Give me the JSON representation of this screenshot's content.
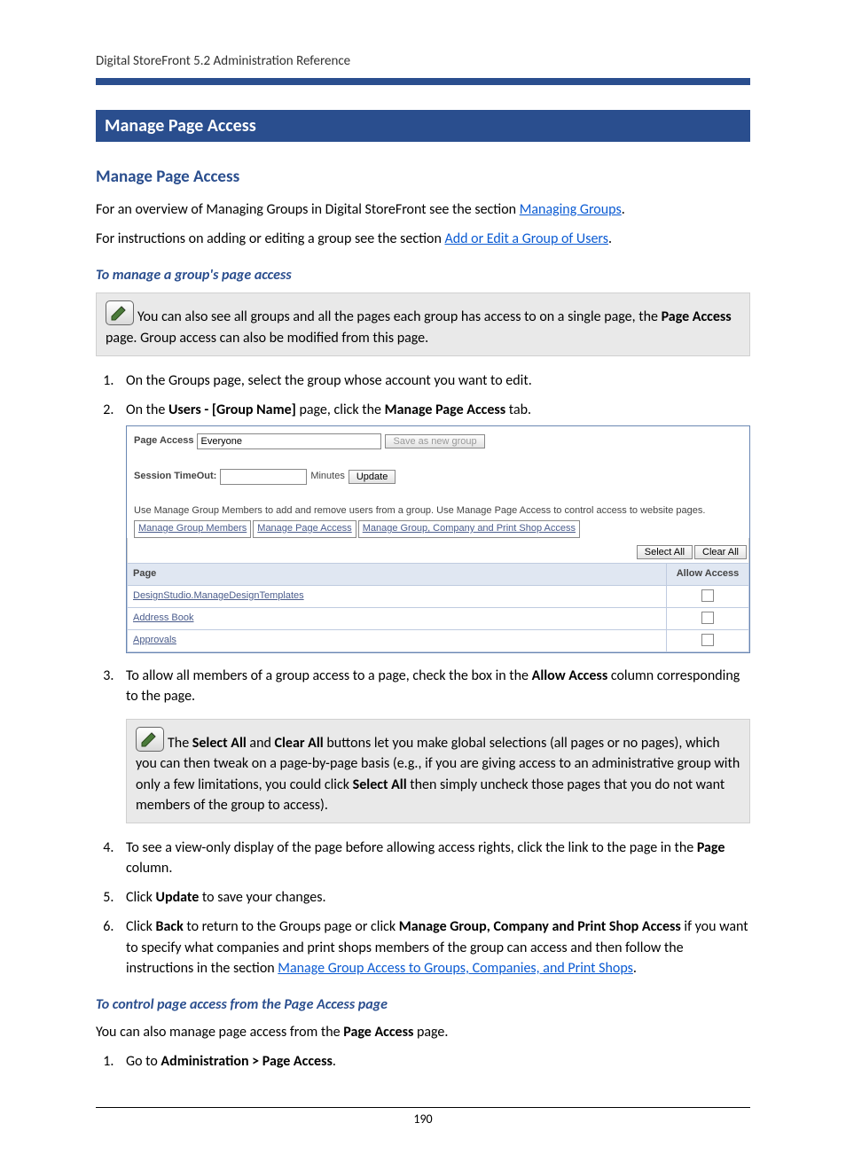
{
  "header": {
    "doc_title": "Digital StoreFront 5.2 Administration Reference"
  },
  "titlebar": "Manage Page Access",
  "h2": "Manage Page Access",
  "para1_a": "For an overview of Managing Groups in Digital StoreFront see the section ",
  "link1": "Managing Groups",
  "para1_b": ".",
  "para2_a": "For instructions on adding or editing a group see the section ",
  "link2": "Add or Edit a Group of Users",
  "para2_b": ".",
  "subhead1": "To manage a group's page access",
  "note1_a": "You can also see all groups and all the pages each group has access to on a single page, the ",
  "note1_b": "Page Access",
  "note1_c": " page. Group access can also be modified from this page.",
  "step1": "On the Groups page, select the group whose account you want to edit.",
  "step2_a": "On the ",
  "step2_b": "Users - [Group Name]",
  "step2_c": " page, click the ",
  "step2_d": "Manage Page Access",
  "step2_e": " tab.",
  "ui": {
    "page_access_label": "Page Access",
    "page_access_value": "Everyone",
    "save_as_new": "Save as new group",
    "session_timeout_label": "Session TimeOut:",
    "minutes": "Minutes",
    "update": "Update",
    "help_text": "Use Manage Group Members to add and remove users from a group. Use Manage Page Access to control access to website pages.",
    "tab1": "Manage Group Members",
    "tab2": "Manage Page Access",
    "tab3": "Manage Group, Company and Print Shop Access",
    "select_all": "Select All",
    "clear_all": "Clear All",
    "col_page": "Page",
    "col_allow": "Allow Access",
    "rows": [
      {
        "page": "DesignStudio.ManageDesignTemplates"
      },
      {
        "page": "Address Book"
      },
      {
        "page": "Approvals"
      }
    ]
  },
  "step3_a": "To allow all members of a group access to a page, check the box in the ",
  "step3_b": "Allow Access",
  "step3_c": " column corresponding to the page.",
  "note2_a": "The ",
  "note2_b": "Select All",
  "note2_c": " and ",
  "note2_d": "Clear All",
  "note2_e": " buttons let you make global selections (all pages or no pages), which you can then tweak on a page-by-page basis (e.g., if you are giving access to an administrative group with only a few limitations, you could click ",
  "note2_f": "Select All",
  "note2_g": " then simply uncheck those pages that you do not want members of the group to access).",
  "step4_a": "To see a view-only display of the page before allowing access rights, click the link to the page in the ",
  "step4_b": "Page",
  "step4_c": " column.",
  "step5_a": "Click ",
  "step5_b": "Update",
  "step5_c": " to save your changes.",
  "step6_a": "Click ",
  "step6_b": "Back",
  "step6_c": " to return to the Groups page or click ",
  "step6_d": "Manage Group, Company and Print Shop Access",
  "step6_e": " if you want to specify what companies and print shops members of the group can access and then follow the instructions in the section ",
  "link3": "Manage Group Access to Groups, Companies, and Print Shops",
  "step6_f": ".",
  "subhead2": "To control page access from the Page Access page",
  "para3_a": "You can also manage page access from the ",
  "para3_b": "Page Access",
  "para3_c": " page.",
  "step_b1_a": "Go to ",
  "step_b1_b": "Administration > Page Access",
  "step_b1_c": ".",
  "page_number": "190"
}
